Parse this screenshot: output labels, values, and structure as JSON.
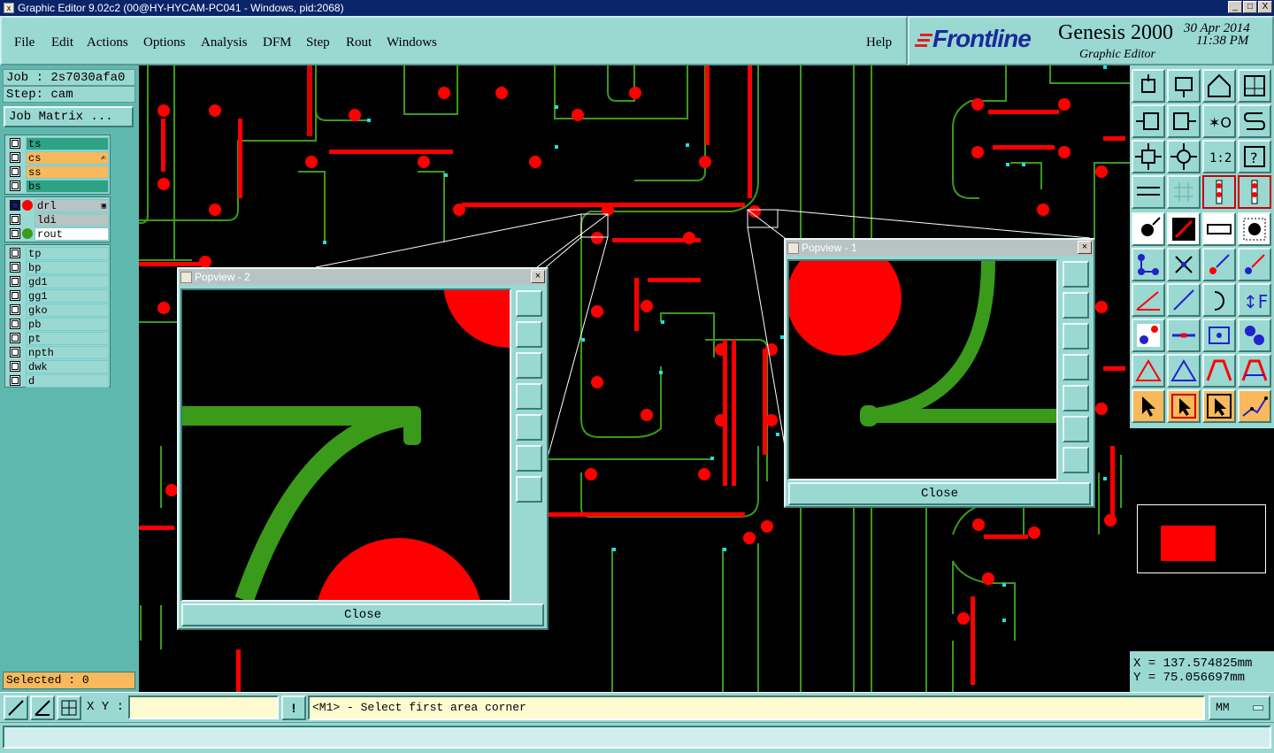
{
  "window": {
    "title": "Graphic Editor 9.02c2 (00@HY-HYCAM-PC041 - Windows, pid:2068)",
    "min": "_",
    "max": "□",
    "close": "X"
  },
  "menu": [
    "File",
    "Edit",
    "Actions",
    "Options",
    "Analysis",
    "DFM",
    "Step",
    "Rout",
    "Windows"
  ],
  "help": "Help",
  "brand": {
    "logo": "Frontline",
    "product": "Genesis 2000",
    "subtitle": "Graphic Editor",
    "date": "30 Apr 2014",
    "time": "11:38 PM"
  },
  "job": {
    "job_label": "Job : 2s7030afa0",
    "step_label": "Step: cam",
    "matrix_button": "Job Matrix ..."
  },
  "layers_group1": [
    {
      "name": "ts",
      "color": "#2ea383"
    },
    {
      "name": "cs",
      "color": "#f8b85c",
      "marker": "✍"
    },
    {
      "name": "ss",
      "color": "#f8b85c"
    },
    {
      "name": "bs",
      "color": "#2ea383"
    }
  ],
  "layers_group2": [
    {
      "name": "drl",
      "color": "#b8c4c4",
      "dot": "#ff0000",
      "mark": "▣"
    },
    {
      "name": "ldi",
      "color": "#b8c4c4",
      "dot": ""
    },
    {
      "name": "rout",
      "color": "#b8c4c4",
      "dot": "#3a9a1a"
    }
  ],
  "layers_group3": [
    {
      "name": "tp"
    },
    {
      "name": "bp"
    },
    {
      "name": "gd1"
    },
    {
      "name": "gg1"
    },
    {
      "name": "gko"
    },
    {
      "name": "pb"
    },
    {
      "name": "pt"
    },
    {
      "name": "npth"
    },
    {
      "name": "dwk"
    },
    {
      "name": "d"
    }
  ],
  "selected": "Selected : 0",
  "popview2": {
    "title": "Popview - 2",
    "close": "Close"
  },
  "popview1": {
    "title": "Popview - 1",
    "close": "Close"
  },
  "coords": {
    "x": "X  = 137.574825mm",
    "y": "Y  = 75.056697mm"
  },
  "cmd": {
    "xy_label": "X Y :",
    "xy_value": "",
    "warn": "!",
    "prompt": "<M1> - Select first area corner",
    "units": "MM"
  },
  "colors": {
    "panel": "#9ad8d2",
    "trace": "#3a9a1a",
    "pad": "#ff0000",
    "background": "#000000"
  }
}
